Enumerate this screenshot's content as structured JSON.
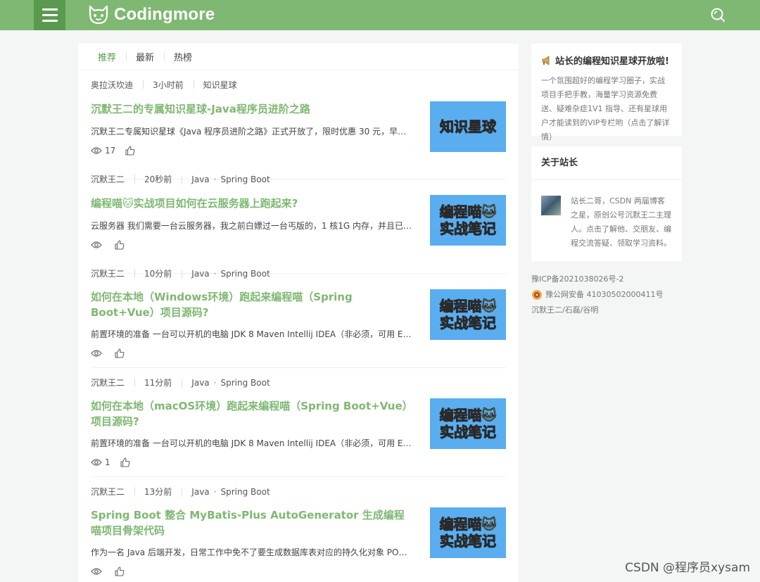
{
  "header": {
    "brand": "Codingmore"
  },
  "tabs": [
    "推荐",
    "最新",
    "热榜"
  ],
  "articles": [
    {
      "author": "奥拉沃坎迪",
      "time": "3小时前",
      "category": "知识星球",
      "tags": [],
      "title": "沉默王二的专属知识星球-Java程序员进阶之路",
      "excerpt": "沉默王二专属知识星球《Java 程序员进阶之路》正式开放了，限时优惠 30 元，早买早享受…",
      "views": "17",
      "likes": "",
      "thumb": [
        "知识星球"
      ]
    },
    {
      "author": "沉默王二",
      "time": "20秒前",
      "category": "Java",
      "tags": [
        "Spring Boot"
      ],
      "title": "编程喵🐱实战项目如何在云服务器上跑起来?",
      "excerpt": "云服务器 我们需要一台云服务器，我之前白嫖过一台丐版的，1 核1G 内存，并且已经安装了…",
      "views": "",
      "likes": "",
      "thumb": [
        "编程喵🐱",
        "实战笔记"
      ]
    },
    {
      "author": "沉默王二",
      "time": "10分前",
      "category": "Java",
      "tags": [
        "Spring Boot"
      ],
      "title": "如何在本地（Windows环境）跑起来编程喵（Spring Boot+Vue）项目源码?",
      "excerpt": "前置环境的准备 一台可以开机的电脑 JDK 8 Maven Intellij IDEA（非必须，可用 Eclipse…",
      "views": "",
      "likes": "",
      "thumb": [
        "编程喵🐱",
        "实战笔记"
      ]
    },
    {
      "author": "沉默王二",
      "time": "11分前",
      "category": "Java",
      "tags": [
        "Spring Boot"
      ],
      "title": "如何在本地（macOS环境）跑起来编程喵（Spring Boot+Vue）项目源码?",
      "excerpt": "前置环境的准备 一台可以开机的电脑 JDK 8 Maven Intellij IDEA（非必须，可用 Eclipse…",
      "views": "1",
      "likes": "",
      "thumb": [
        "编程喵🐱",
        "实战笔记"
      ]
    },
    {
      "author": "沉默王二",
      "time": "13分前",
      "category": "Java",
      "tags": [
        "Spring Boot"
      ],
      "title": "Spring Boot 整合 MyBatis-Plus AutoGenerator 生成编程喵项目骨架代码",
      "excerpt": "作为一名 Java 后端开发，日常工作中免不了要生成数据库表对应的持久化对象 PO，操作数据…",
      "views": "",
      "likes": "",
      "thumb": [
        "编程喵🐱",
        "实战笔记"
      ]
    }
  ],
  "sidebar": {
    "promo_title": "站长的编程知识星球开放啦!",
    "promo_body": "一个氛围超好的编程学习圈子，实战项目手把手教，海量学习资源免费送、疑难杂症1V1 指导、还有星球用户才能读到的VIP专栏哟（点击了解详情）",
    "about_title": "关于站长",
    "about_body": "站长二哥，CSDN 两届博客之星，原创公号沉默王二主理人。点击了解他、交朋友、编程交流答疑、领取学习资料。",
    "icp": "豫ICP备2021038026号-2",
    "police": "豫公网安备 41030502000411号",
    "credits": "沉默王二/石磊/谷明"
  },
  "watermark": "CSDN @程序员xysam",
  "colors": {
    "header": "#7fb872",
    "menu_button": "#5a9a4f",
    "title_green": "#7fb872",
    "thumb_blue": "#5aaef0",
    "thumb_text": "#f6e23c"
  }
}
